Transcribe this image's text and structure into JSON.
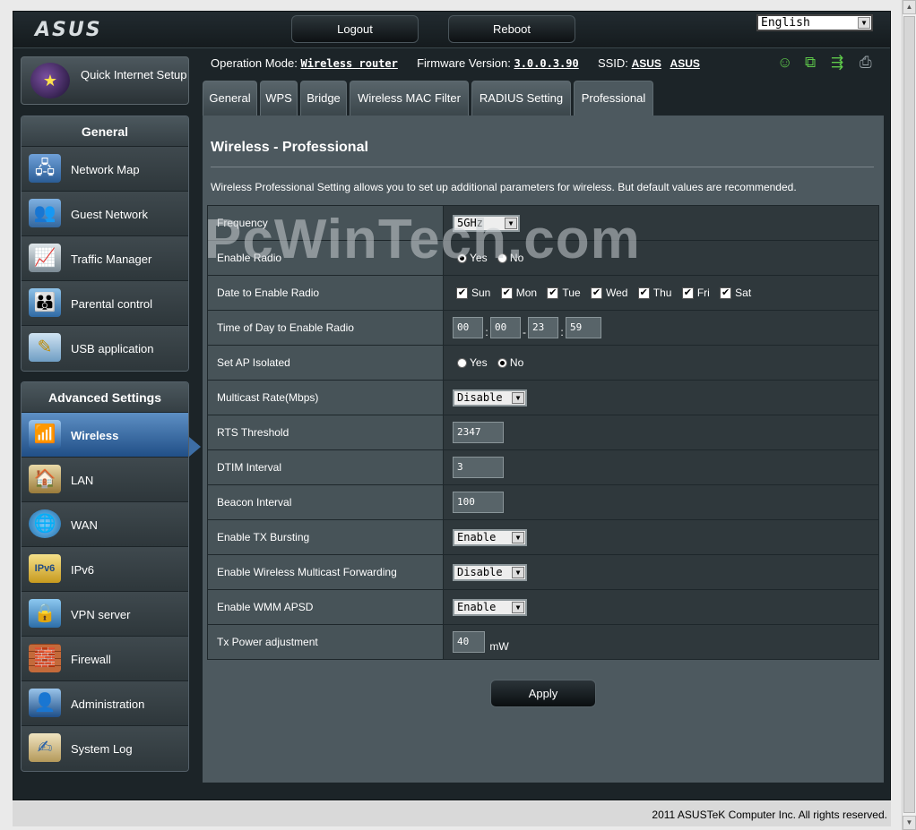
{
  "header": {
    "logo": "ASUS",
    "logout_label": "Logout",
    "reboot_label": "Reboot",
    "language": "English"
  },
  "sidebar": {
    "quick_setup_label": "Quick Internet Setup",
    "general_heading": "General",
    "general_items": [
      {
        "label": "Network Map",
        "icon": "network-map-icon"
      },
      {
        "label": "Guest Network",
        "icon": "guest-network-icon"
      },
      {
        "label": "Traffic Manager",
        "icon": "traffic-manager-icon"
      },
      {
        "label": "Parental control",
        "icon": "parental-control-icon"
      },
      {
        "label": "USB application",
        "icon": "usb-application-icon"
      }
    ],
    "advanced_heading": "Advanced Settings",
    "advanced_items": [
      {
        "label": "Wireless",
        "icon": "wireless-icon",
        "active": true
      },
      {
        "label": "LAN",
        "icon": "lan-icon"
      },
      {
        "label": "WAN",
        "icon": "wan-icon"
      },
      {
        "label": "IPv6",
        "icon": "ipv6-icon"
      },
      {
        "label": "VPN server",
        "icon": "vpn-icon"
      },
      {
        "label": "Firewall",
        "icon": "firewall-icon"
      },
      {
        "label": "Administration",
        "icon": "administration-icon"
      },
      {
        "label": "System Log",
        "icon": "system-log-icon"
      }
    ]
  },
  "info": {
    "op_mode_label": "Operation Mode:",
    "op_mode_value": "Wireless router",
    "fw_label": "Firmware Version:",
    "fw_value": "3.0.0.3.90",
    "ssid_label": "SSID:",
    "ssid_1": "ASUS",
    "ssid_2": "ASUS"
  },
  "tabs": [
    "General",
    "WPS",
    "Bridge",
    "Wireless MAC Filter",
    "RADIUS Setting",
    "Professional"
  ],
  "panel": {
    "title": "Wireless - Professional",
    "description": "Wireless Professional Setting allows you to set up additional parameters for wireless. But default values are recommended."
  },
  "form": {
    "frequency_label": "Frequency",
    "frequency_value": "5GHz",
    "enable_radio_label": "Enable Radio",
    "yes": "Yes",
    "no": "No",
    "date_label": "Date to Enable Radio",
    "days": [
      "Sun",
      "Mon",
      "Tue",
      "Wed",
      "Thu",
      "Fri",
      "Sat"
    ],
    "time_label": "Time of Day to Enable Radio",
    "time_values": [
      "00",
      "00",
      "23",
      "59"
    ],
    "ap_isolated_label": "Set AP Isolated",
    "multicast_label": "Multicast Rate(Mbps)",
    "multicast_value": "Disable",
    "rts_label": "RTS Threshold",
    "rts_value": "2347",
    "dtim_label": "DTIM Interval",
    "dtim_value": "3",
    "beacon_label": "Beacon Interval",
    "beacon_value": "100",
    "txburst_label": "Enable TX Bursting",
    "txburst_value": "Enable",
    "wmf_label": "Enable Wireless Multicast Forwarding",
    "wmf_value": "Disable",
    "apsd_label": "Enable WMM APSD",
    "apsd_value": "Enable",
    "txpower_label": "Tx Power adjustment",
    "txpower_value": "40",
    "txpower_unit": "mW",
    "apply_label": "Apply"
  },
  "footer": "2011 ASUSTeK Computer Inc. All rights reserved.",
  "watermark": "PcWinTech.com"
}
